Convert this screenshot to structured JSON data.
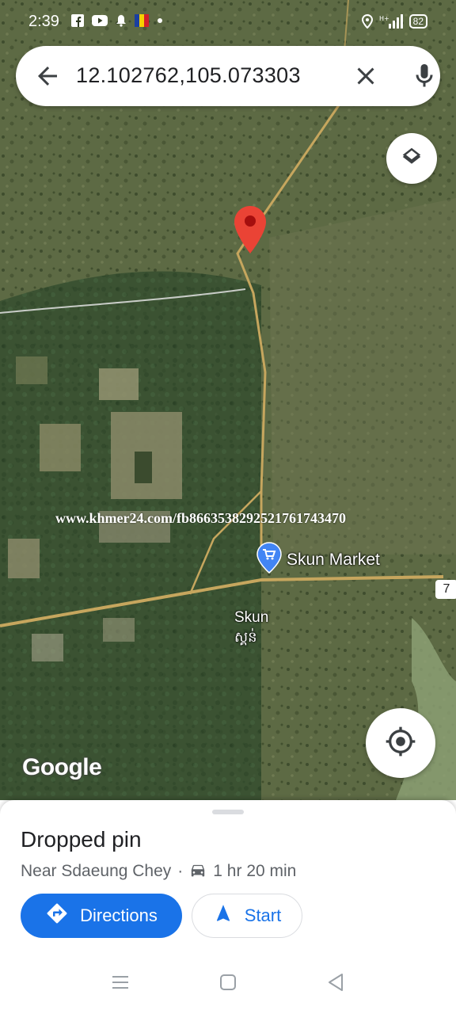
{
  "status_bar": {
    "time": "2:39",
    "battery": "82"
  },
  "search": {
    "query": "12.102762,105.073303"
  },
  "map": {
    "watermark": "www.khmer24.com/fb8663538292521761743470",
    "poi_label": "Skun Market",
    "town_name": "Skun",
    "town_name_khmer": "ស្គន់",
    "road_number": "7",
    "google_logo": "Google"
  },
  "sheet": {
    "title": "Dropped pin",
    "location": "Near Sdaeung Chey",
    "separator": "·",
    "drive_time": "1 hr 20 min",
    "directions_label": "Directions",
    "start_label": "Start"
  },
  "colors": {
    "accent": "#1a73e8",
    "pin": "#ea4335",
    "poi": "#4285f4"
  },
  "icons": {
    "back": "arrow-left-icon",
    "clear": "close-icon",
    "mic": "microphone-icon",
    "layers": "layers-icon",
    "locate": "my-location-icon",
    "car": "car-icon",
    "directions": "directions-icon",
    "start": "navigation-arrow-icon"
  }
}
